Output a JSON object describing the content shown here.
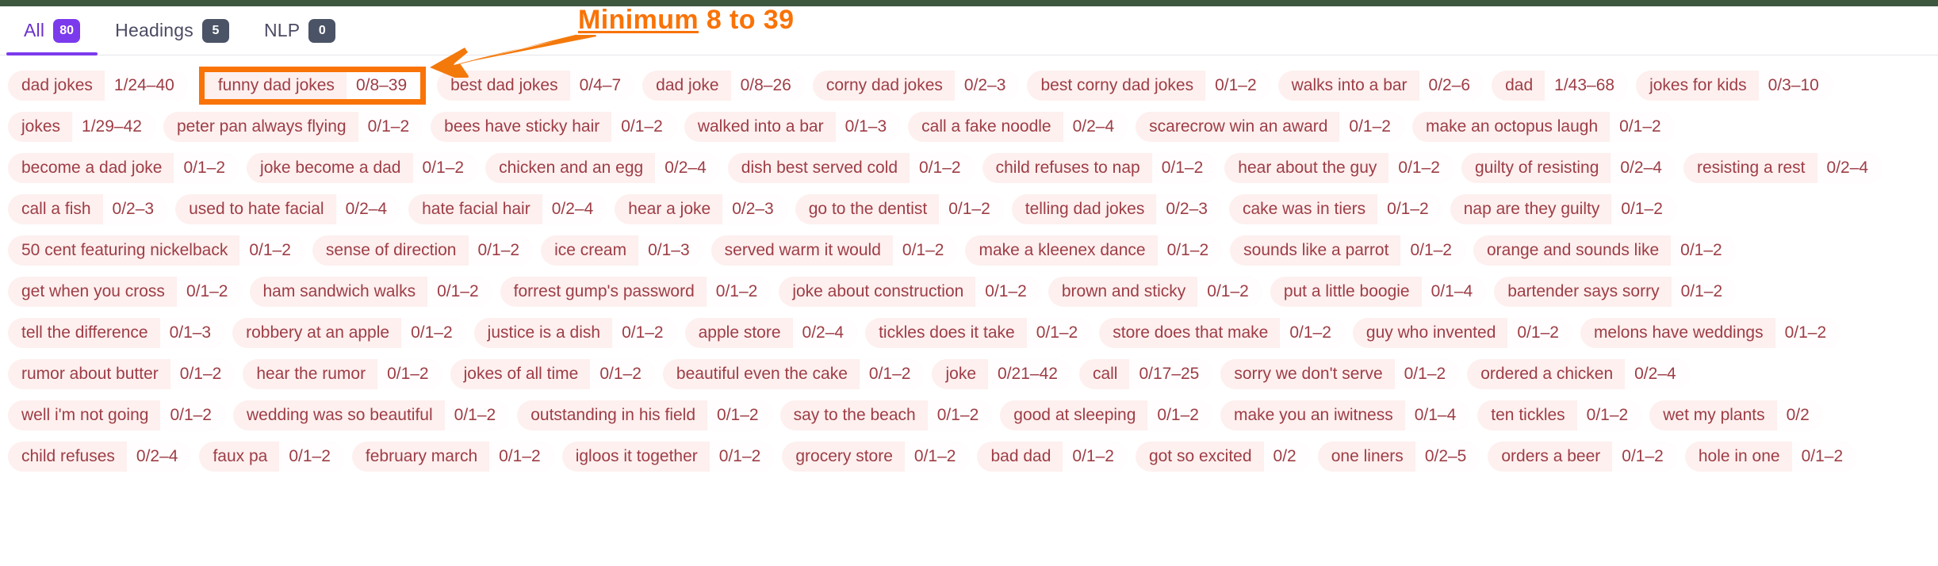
{
  "tabs": [
    {
      "label": "All",
      "badge": "80",
      "active": true
    },
    {
      "label": "Headings",
      "badge": "5",
      "active": false
    },
    {
      "label": "NLP",
      "badge": "0",
      "active": false
    }
  ],
  "annotation": {
    "underlined": "Minimum",
    "rest": " 8 to 39",
    "color": "#f97307",
    "arrow_icon": "arrow-left-icon"
  },
  "colors": {
    "accent_purple": "#7c3aed",
    "badge_gray": "#4b5366",
    "chip_bg": "#fdf0ef",
    "chip_text": "#9e3d46",
    "annotation_orange": "#f97307",
    "top_strip": "#3e573f"
  },
  "chip_rows": [
    [
      {
        "term": "dad jokes",
        "count": "1/24–40",
        "highlight": false
      },
      {
        "term": "funny dad jokes",
        "count": "0/8–39",
        "highlight": true
      },
      {
        "term": "best dad jokes",
        "count": "0/4–7",
        "highlight": false
      },
      {
        "term": "dad joke",
        "count": "0/8–26",
        "highlight": false
      },
      {
        "term": "corny dad jokes",
        "count": "0/2–3",
        "highlight": false
      },
      {
        "term": "best corny dad jokes",
        "count": "0/1–2",
        "highlight": false
      },
      {
        "term": "walks into a bar",
        "count": "0/2–6",
        "highlight": false
      },
      {
        "term": "dad",
        "count": "1/43–68",
        "highlight": false
      },
      {
        "term": "jokes for kids",
        "count": "0/3–10",
        "highlight": false
      }
    ],
    [
      {
        "term": "jokes",
        "count": "1/29–42",
        "highlight": false
      },
      {
        "term": "peter pan always flying",
        "count": "0/1–2",
        "highlight": false
      },
      {
        "term": "bees have sticky hair",
        "count": "0/1–2",
        "highlight": false
      },
      {
        "term": "walked into a bar",
        "count": "0/1–3",
        "highlight": false
      },
      {
        "term": "call a fake noodle",
        "count": "0/2–4",
        "highlight": false
      },
      {
        "term": "scarecrow win an award",
        "count": "0/1–2",
        "highlight": false
      },
      {
        "term": "make an octopus laugh",
        "count": "0/1–2",
        "highlight": false
      }
    ],
    [
      {
        "term": "become a dad joke",
        "count": "0/1–2",
        "highlight": false
      },
      {
        "term": "joke become a dad",
        "count": "0/1–2",
        "highlight": false
      },
      {
        "term": "chicken and an egg",
        "count": "0/2–4",
        "highlight": false
      },
      {
        "term": "dish best served cold",
        "count": "0/1–2",
        "highlight": false
      },
      {
        "term": "child refuses to nap",
        "count": "0/1–2",
        "highlight": false
      },
      {
        "term": "hear about the guy",
        "count": "0/1–2",
        "highlight": false
      },
      {
        "term": "guilty of resisting",
        "count": "0/2–4",
        "highlight": false
      },
      {
        "term": "resisting a rest",
        "count": "0/2–4",
        "highlight": false
      }
    ],
    [
      {
        "term": "call a fish",
        "count": "0/2–3",
        "highlight": false
      },
      {
        "term": "used to hate facial",
        "count": "0/2–4",
        "highlight": false
      },
      {
        "term": "hate facial hair",
        "count": "0/2–4",
        "highlight": false
      },
      {
        "term": "hear a joke",
        "count": "0/2–3",
        "highlight": false
      },
      {
        "term": "go to the dentist",
        "count": "0/1–2",
        "highlight": false
      },
      {
        "term": "telling dad jokes",
        "count": "0/2–3",
        "highlight": false
      },
      {
        "term": "cake was in tiers",
        "count": "0/1–2",
        "highlight": false
      },
      {
        "term": "nap are they guilty",
        "count": "0/1–2",
        "highlight": false
      }
    ],
    [
      {
        "term": "50 cent featuring nickelback",
        "count": "0/1–2",
        "highlight": false
      },
      {
        "term": "sense of direction",
        "count": "0/1–2",
        "highlight": false
      },
      {
        "term": "ice cream",
        "count": "0/1–3",
        "highlight": false
      },
      {
        "term": "served warm it would",
        "count": "0/1–2",
        "highlight": false
      },
      {
        "term": "make a kleenex dance",
        "count": "0/1–2",
        "highlight": false
      },
      {
        "term": "sounds like a parrot",
        "count": "0/1–2",
        "highlight": false
      },
      {
        "term": "orange and sounds like",
        "count": "0/1–2",
        "highlight": false
      }
    ],
    [
      {
        "term": "get when you cross",
        "count": "0/1–2",
        "highlight": false
      },
      {
        "term": "ham sandwich walks",
        "count": "0/1–2",
        "highlight": false
      },
      {
        "term": "forrest gump's password",
        "count": "0/1–2",
        "highlight": false
      },
      {
        "term": "joke about construction",
        "count": "0/1–2",
        "highlight": false
      },
      {
        "term": "brown and sticky",
        "count": "0/1–2",
        "highlight": false
      },
      {
        "term": "put a little boogie",
        "count": "0/1–4",
        "highlight": false
      },
      {
        "term": "bartender says sorry",
        "count": "0/1–2",
        "highlight": false
      }
    ],
    [
      {
        "term": "tell the difference",
        "count": "0/1–3",
        "highlight": false
      },
      {
        "term": "robbery at an apple",
        "count": "0/1–2",
        "highlight": false
      },
      {
        "term": "justice is a dish",
        "count": "0/1–2",
        "highlight": false
      },
      {
        "term": "apple store",
        "count": "0/2–4",
        "highlight": false
      },
      {
        "term": "tickles does it take",
        "count": "0/1–2",
        "highlight": false
      },
      {
        "term": "store does that make",
        "count": "0/1–2",
        "highlight": false
      },
      {
        "term": "guy who invented",
        "count": "0/1–2",
        "highlight": false
      },
      {
        "term": "melons have weddings",
        "count": "0/1–2",
        "highlight": false
      }
    ],
    [
      {
        "term": "rumor about butter",
        "count": "0/1–2",
        "highlight": false
      },
      {
        "term": "hear the rumor",
        "count": "0/1–2",
        "highlight": false
      },
      {
        "term": "jokes of all time",
        "count": "0/1–2",
        "highlight": false
      },
      {
        "term": "beautiful even the cake",
        "count": "0/1–2",
        "highlight": false
      },
      {
        "term": "joke",
        "count": "0/21–42",
        "highlight": false
      },
      {
        "term": "call",
        "count": "0/17–25",
        "highlight": false
      },
      {
        "term": "sorry we don't serve",
        "count": "0/1–2",
        "highlight": false
      },
      {
        "term": "ordered a chicken",
        "count": "0/2–4",
        "highlight": false
      }
    ],
    [
      {
        "term": "well i'm not going",
        "count": "0/1–2",
        "highlight": false
      },
      {
        "term": "wedding was so beautiful",
        "count": "0/1–2",
        "highlight": false
      },
      {
        "term": "outstanding in his field",
        "count": "0/1–2",
        "highlight": false
      },
      {
        "term": "say to the beach",
        "count": "0/1–2",
        "highlight": false
      },
      {
        "term": "good at sleeping",
        "count": "0/1–2",
        "highlight": false
      },
      {
        "term": "make you an iwitness",
        "count": "0/1–4",
        "highlight": false
      },
      {
        "term": "ten tickles",
        "count": "0/1–2",
        "highlight": false
      },
      {
        "term": "wet my plants",
        "count": "0/2",
        "highlight": false
      }
    ],
    [
      {
        "term": "child refuses",
        "count": "0/2–4",
        "highlight": false
      },
      {
        "term": "faux pa",
        "count": "0/1–2",
        "highlight": false
      },
      {
        "term": "february march",
        "count": "0/1–2",
        "highlight": false
      },
      {
        "term": "igloos it together",
        "count": "0/1–2",
        "highlight": false
      },
      {
        "term": "grocery store",
        "count": "0/1–2",
        "highlight": false
      },
      {
        "term": "bad dad",
        "count": "0/1–2",
        "highlight": false
      },
      {
        "term": "got so excited",
        "count": "0/2",
        "highlight": false
      },
      {
        "term": "one liners",
        "count": "0/2–5",
        "highlight": false
      },
      {
        "term": "orders a beer",
        "count": "0/1–2",
        "highlight": false
      },
      {
        "term": "hole in one",
        "count": "0/1–2",
        "highlight": false
      }
    ]
  ]
}
